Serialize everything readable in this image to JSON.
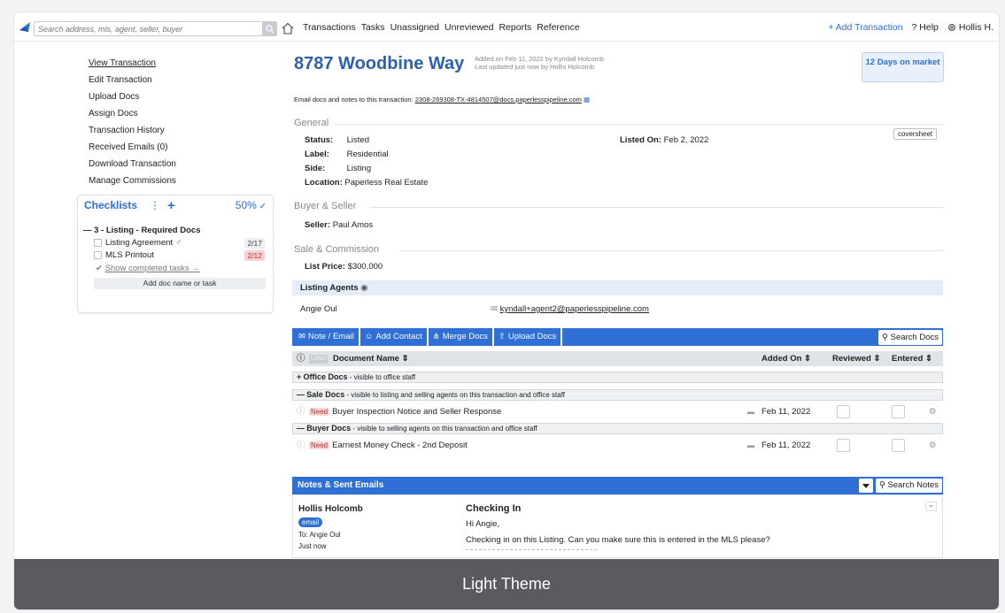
{
  "topbar": {
    "search_placeholder": "Search address, mls, agent, seller, buyer",
    "nav": [
      "Transactions",
      "Tasks",
      "Unassigned",
      "Unreviewed",
      "Reports",
      "Reference"
    ],
    "add_transaction": "+ Add Transaction",
    "help": "? Help",
    "user": "Hollis H."
  },
  "sidebar": {
    "links": [
      "View Transaction",
      "Edit Transaction",
      "Upload Docs",
      "Assign Docs",
      "Transaction History",
      "Received Emails (0)",
      "Download Transaction",
      "Manage Commissions"
    ]
  },
  "checklist": {
    "title": "Checklists",
    "percent": "50%",
    "group": "— 3 - Listing - Required Docs",
    "items": [
      {
        "label": "Listing Agreement",
        "count": "2/17"
      },
      {
        "label": "MLS Printout",
        "count": "2/12"
      }
    ],
    "show_completed": "Show completed tasks →",
    "add_placeholder": "Add doc name or task"
  },
  "transaction": {
    "title": "8787 Woodbine Way",
    "added": "Added on Feb 11, 2022 by Kyndall Holcomb",
    "updated": "Last updated just now by Hollis Holcomb",
    "days_on_market": "12 Days on market",
    "email_prefix": "Email docs and notes to this transaction:",
    "email_address": "2308-269308-TX-4814507@docs.paperlesspipeline.com"
  },
  "general": {
    "label": "General",
    "status_label": "Status:",
    "status": "Listed",
    "label_label": "Label:",
    "label_value": "Residential",
    "side_label": "Side:",
    "side": "Listing",
    "location_label": "Location:",
    "location": "Paperless Real Estate",
    "listed_on_label": "Listed On:",
    "listed_on": "Feb 2, 2022",
    "coversheet": "coversheet"
  },
  "buyer_seller": {
    "label": "Buyer & Seller",
    "seller_label": "Seller:",
    "seller": "Paul Amos"
  },
  "sale": {
    "label": "Sale & Commission",
    "list_price_label": "List Price:",
    "list_price": "$300,000"
  },
  "agents": {
    "label": "Listing Agents",
    "name": "Angie Oul",
    "email": "kyndall+agent2@paperlesspipeline.com"
  },
  "toolbar": {
    "note_email": "Note / Email",
    "add_contact": "Add Contact",
    "merge_docs": "Merge Docs",
    "upload_docs": "Upload Docs",
    "search_docs": "Search Docs"
  },
  "doc_table": {
    "label_tag": "Label",
    "col_name": "Document Name",
    "col_added": "Added On",
    "col_reviewed": "Reviewed",
    "col_entered": "Entered",
    "groups": [
      {
        "sign": "+",
        "name": "Office Docs",
        "desc": "- visible to office staff"
      },
      {
        "sign": "—",
        "name": "Sale Docs",
        "desc": "- visible to listing and selling agents on this transaction and office staff"
      },
      {
        "sign": "—",
        "name": "Buyer Docs",
        "desc": "- visible to selling agents on this transaction and office staff"
      }
    ],
    "rows": [
      {
        "need": "Need",
        "name": "Buyer Inspection Notice and Seller Response",
        "added": "Feb 11, 2022"
      },
      {
        "need": "Need",
        "name": "Earnest Money Check - 2nd Deposit",
        "added": "Feb 11, 2022"
      }
    ]
  },
  "notes": {
    "title": "Notes & Sent Emails",
    "search": "Search Notes",
    "author": "Hollis Holcomb",
    "tag": "email",
    "to": "To: Angie Oul",
    "when": "Just now",
    "subject": "Checking In",
    "greeting": "Hi Angie,",
    "body": "Checking in on this Listing. Can you make sure this is entered in the MLS please?"
  },
  "footer": {
    "label": "Light Theme"
  },
  "colors": {
    "accent": "#2f6fd6",
    "title": "#2d5fb3",
    "footer": "#5a5b5f"
  }
}
